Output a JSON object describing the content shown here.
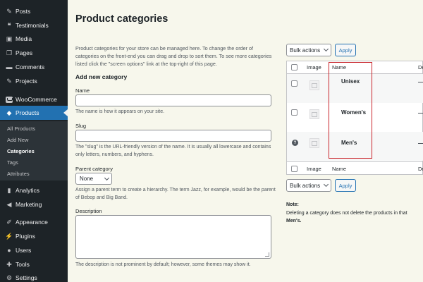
{
  "sidebar": {
    "items": [
      {
        "label": "Posts",
        "icon": "pin-icon"
      },
      {
        "label": "Testimonials",
        "icon": "quote-icon"
      },
      {
        "label": "Media",
        "icon": "media-icon"
      },
      {
        "label": "Pages",
        "icon": "pages-icon"
      },
      {
        "label": "Comments",
        "icon": "comment-icon"
      },
      {
        "label": "Projects",
        "icon": "pin-icon"
      },
      {
        "label": "WooCommerce",
        "icon": "woocommerce-icon"
      },
      {
        "label": "Products",
        "icon": "products-icon"
      },
      {
        "label": "Analytics",
        "icon": "analytics-icon"
      },
      {
        "label": "Marketing",
        "icon": "megaphone-icon"
      },
      {
        "label": "Appearance",
        "icon": "brush-icon"
      },
      {
        "label": "Plugins",
        "icon": "plug-icon"
      },
      {
        "label": "Users",
        "icon": "user-icon"
      },
      {
        "label": "Tools",
        "icon": "wrench-icon"
      },
      {
        "label": "Settings",
        "icon": "gear-icon"
      }
    ],
    "submenu": [
      "All Products",
      "Add New",
      "Categories",
      "Tags",
      "Attributes"
    ],
    "active_item": "Products",
    "current_sub": "Categories",
    "accent": "#2271b1"
  },
  "main": {
    "title": "Product categories",
    "intro": "Product categories for your store can be managed here. To change the order of categories on the front-end you can drag and drop to sort them. To see more categories listed click the \"screen options\" link at the top-right of this page.",
    "add_heading": "Add new category",
    "name_label": "Name",
    "name_value": "",
    "name_help": "The name is how it appears on your site.",
    "slug_label": "Slug",
    "slug_value": "",
    "slug_help": "The \"slug\" is the URL-friendly version of the name. It is usually all lowercase and contains only letters, numbers, and hyphens.",
    "parent_label": "Parent category",
    "parent_value": "None",
    "parent_help": "Assign a parent term to create a hierarchy. The term Jazz, for example, would be the parent of Bebop and Big Band.",
    "description_label": "Description",
    "description_help": "The description is not prominent by default; however, some themes may show it."
  },
  "table": {
    "bulk_actions": "Bulk actions",
    "apply": "Apply",
    "columns": {
      "image": "Image",
      "name": "Name",
      "description": "De"
    },
    "rows": [
      {
        "name": "Unisex"
      },
      {
        "name": "Women's"
      },
      {
        "name": "Men's"
      }
    ],
    "note_heading": "Note:",
    "note_text": "Deleting a category does not delete the products in that",
    "note_text_2": "Men's.",
    "highlight_color": "#c9252b"
  }
}
